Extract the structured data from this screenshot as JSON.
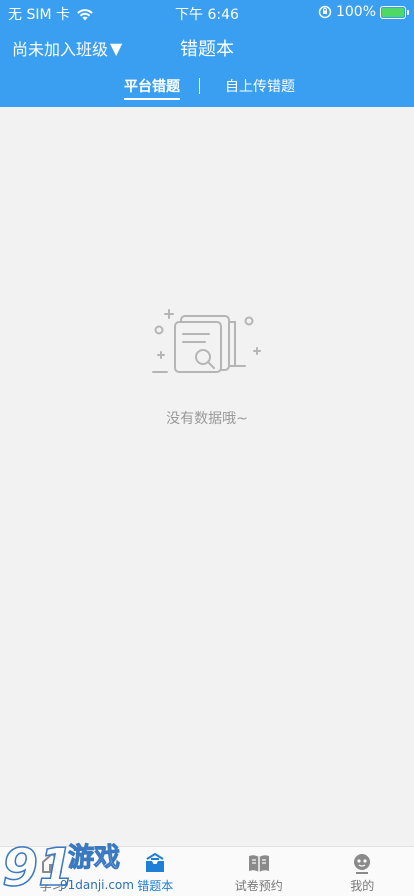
{
  "status_bar": {
    "carrier": "无 SIM 卡",
    "time": "下午 6:46",
    "battery": "100%",
    "battery_level": 1.0
  },
  "header": {
    "class_select_label": "尚未加入班级",
    "class_select_arrow": "▼",
    "title": "错题本"
  },
  "tabs": [
    {
      "label": "平台错题",
      "active": true
    },
    {
      "label": "自上传错题",
      "active": false
    }
  ],
  "empty_state": {
    "message": "没有数据哦~",
    "icon": "document-search-icon"
  },
  "tab_bar": [
    {
      "label": "学习",
      "icon": "home-icon",
      "active": false
    },
    {
      "label": "错题本",
      "icon": "inbox-icon",
      "active": true
    },
    {
      "label": "试卷预约",
      "icon": "book-icon",
      "active": false
    },
    {
      "label": "我的",
      "icon": "profile-icon",
      "active": false
    }
  ],
  "watermark": {
    "number": "91",
    "text": "游戏",
    "url": "91danji.com"
  },
  "colors": {
    "header_bg": "#3a9ff0",
    "tab_active": "#1e7fd6",
    "page_bg": "#f2f2f2"
  }
}
